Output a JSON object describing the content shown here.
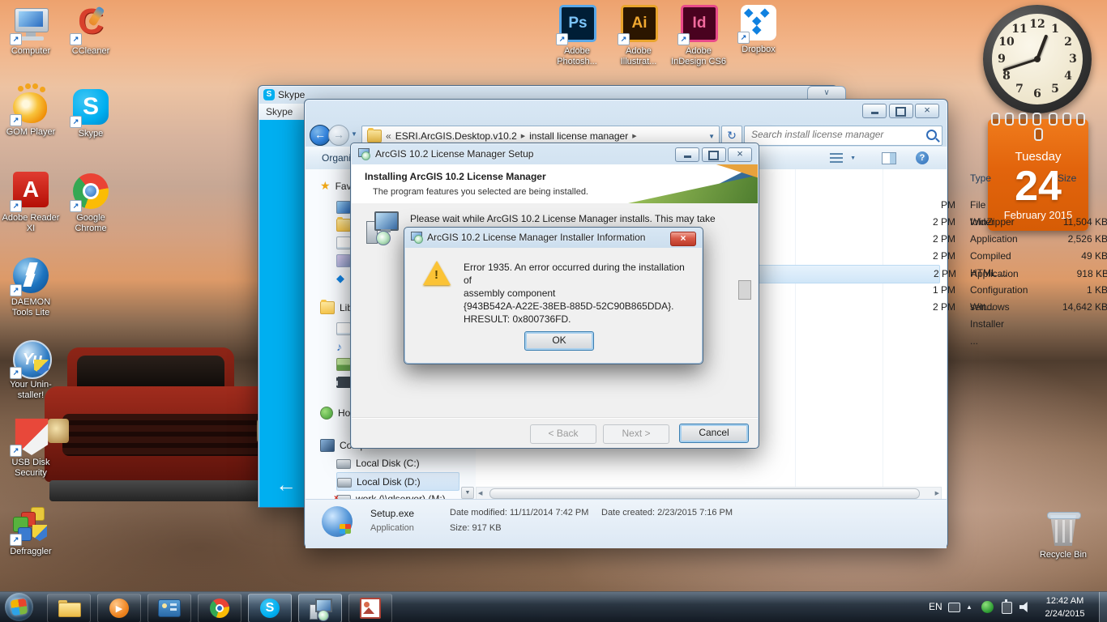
{
  "colors": {
    "skype_blue": "#00aff0",
    "calendar_orange": "#e2640c",
    "aero_glass": "#b8cfe4",
    "selection_blue": "#d0e6f8",
    "taskbar_dark": "#16202c"
  },
  "desktop": {
    "icons": [
      {
        "name": "computer",
        "label": "Computer"
      },
      {
        "name": "ccleaner",
        "label": "CCleaner"
      },
      {
        "name": "gom-player",
        "label": "GOM Player"
      },
      {
        "name": "skype",
        "label": "Skype"
      },
      {
        "name": "adobe-reader",
        "label": "Adobe Reader XI"
      },
      {
        "name": "google-chrome",
        "label": "Google Chrome"
      },
      {
        "name": "daemon-tools",
        "label": "DAEMON Tools Lite"
      },
      {
        "name": "your-uninstaller",
        "label": "Your Unin-staller!"
      },
      {
        "name": "usb-disk-security",
        "label": "USB Disk Security"
      },
      {
        "name": "defraggler",
        "label": "Defraggler"
      },
      {
        "name": "adobe-photoshop",
        "label": "Adobe Photosh..."
      },
      {
        "name": "adobe-illustrator",
        "label": "Adobe Illustrat..."
      },
      {
        "name": "adobe-indesign",
        "label": "Adobe InDesign CS6"
      },
      {
        "name": "dropbox",
        "label": "Dropbox"
      },
      {
        "name": "recycle-bin",
        "label": "Recycle Bin"
      }
    ]
  },
  "gadgets": {
    "clock": {
      "numbers": [
        "12",
        "1",
        "2",
        "3",
        "4",
        "5",
        "6",
        "7",
        "8",
        "9",
        "10",
        "11"
      ]
    },
    "calendar": {
      "day": "Tuesday",
      "date": "24",
      "month_year": "February 2015"
    }
  },
  "skype_window": {
    "title": "Skype",
    "menu_item": "Skype"
  },
  "explorer": {
    "address": {
      "overflow": "«",
      "crumbs": [
        "ESRI.ArcGIS.Desktop.v10.2",
        "install license manager"
      ]
    },
    "search": {
      "placeholder": "Search install license manager"
    },
    "toolbar": {
      "organize_label": "Organize"
    },
    "nav": {
      "sections": [
        {
          "label": "Favorites"
        },
        {
          "label": "Libraries"
        },
        {
          "label": "Homegroup"
        },
        {
          "label": "Computer"
        }
      ],
      "drives": [
        {
          "label": "Local Disk (C:)"
        },
        {
          "label": "Local Disk (D:)"
        },
        {
          "label": "work (\\\\qlserver) (M:)"
        }
      ]
    },
    "files": {
      "headers": {
        "type": "Type",
        "size": "Size"
      },
      "rows": [
        {
          "time": "PM",
          "type": "File folder",
          "size": ""
        },
        {
          "time": "2 PM",
          "type": "WinZipper",
          "size": "11,504 KB"
        },
        {
          "time": "2 PM",
          "type": "Application",
          "size": "2,526 KB"
        },
        {
          "time": "2 PM",
          "type": "Compiled HTML ...",
          "size": "49 KB"
        },
        {
          "time": "2 PM",
          "type": "Application",
          "size": "918 KB"
        },
        {
          "time": "1 PM",
          "type": "Configuration sett...",
          "size": "1 KB"
        },
        {
          "time": "2 PM",
          "type": "Windows Installer ...",
          "size": "14,642 KB"
        }
      ]
    },
    "details": {
      "name": "Setup.exe",
      "type": "Application",
      "modified": "Date modified: 11/11/2014 7:42 PM",
      "size": "Size: 917 KB",
      "created": "Date created: 2/23/2015 7:16 PM"
    }
  },
  "setup_dialog": {
    "title": "ArcGIS 10.2 License Manager Setup",
    "heading": "Installing ArcGIS 10.2 License Manager",
    "subheading": "The program features you selected are being installed.",
    "status": "Please wait while ArcGIS 10.2 License Manager installs. This may take",
    "back_label": "< Back",
    "next_label": "Next >",
    "cancel_label": "Cancel"
  },
  "error_dialog": {
    "title": "ArcGIS 10.2 License Manager Installer Information",
    "message_lines": [
      "Error 1935. An error occurred during the installation of",
      "assembly component",
      "{943B542A-A22E-38EB-885D-52C90B865DDA}.",
      "HRESULT: 0x800736FD."
    ],
    "ok_label": "OK"
  },
  "taskbar": {
    "tray": {
      "language": "EN",
      "time": "12:42 AM",
      "date": "2/24/2015"
    }
  },
  "glyphs": {
    "shortcut_arrow": "↗",
    "crumb_sep": "▶",
    "dropdown": "▼",
    "back_arrow": "←",
    "forward_arrow": "→",
    "refresh": "↻",
    "help": "?",
    "star": "★",
    "music_note": "♪",
    "diamond": "◆",
    "chevron_down": "∨",
    "close": "×",
    "warning_mark": "!",
    "scroll_left": "◀",
    "scroll_right": "▶",
    "scroll_down": "▼",
    "hidden_icons": "▲",
    "skype_nav_arrow": "←",
    "play": "▶",
    "ps": "Ps",
    "ai": "Ai",
    "id": "Id",
    "skype_s": "S",
    "yu": "Yu",
    "ccleaner_c": "C"
  }
}
